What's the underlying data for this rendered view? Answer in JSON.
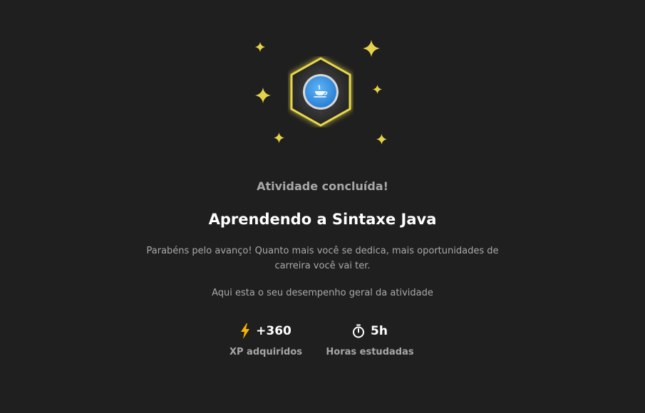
{
  "completion": {
    "badge_icon": "java-cup-icon",
    "status": "Atividade concluída!",
    "course_title": "Aprendendo a Sintaxe Java",
    "message": "Parabéns pelo avanço! Quanto mais você se dedica, mais oportunidades de carreira você vai ter.",
    "summary": "Aqui esta o seu desempenho geral da atividade"
  },
  "stats": [
    {
      "icon": "lightning-icon",
      "value": "+360",
      "label": "XP adquiridos"
    },
    {
      "icon": "stopwatch-icon",
      "value": "5h",
      "label": "Horas estudadas"
    }
  ],
  "colors": {
    "background": "#1f1f1f",
    "accent_yellow": "#f5e04a",
    "badge_blue": "#2f8de4",
    "xp_icon": "#f7b500"
  }
}
